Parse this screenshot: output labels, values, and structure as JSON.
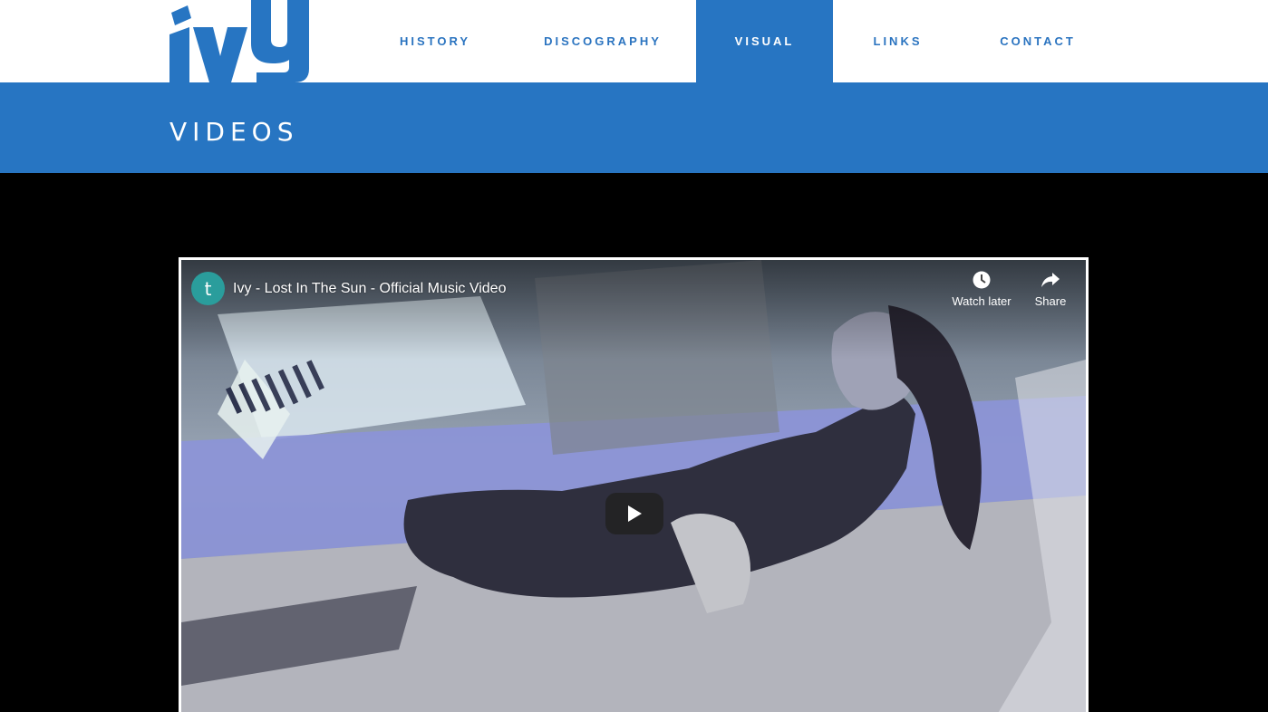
{
  "brand": {
    "logo_text": "ivy",
    "color": "#2775c2"
  },
  "nav": {
    "items": [
      {
        "label": "HISTORY",
        "active": false
      },
      {
        "label": "DISCOGRAPHY",
        "active": false
      },
      {
        "label": "VISUAL",
        "active": true
      },
      {
        "label": "LINKS",
        "active": false
      },
      {
        "label": "CONTACT",
        "active": false
      }
    ]
  },
  "banner": {
    "title": "VIDEOS"
  },
  "video": {
    "channel_initial": "t",
    "title": "Ivy - Lost In The Sun - Official Music Video",
    "watch_later_label": "Watch later",
    "share_label": "Share",
    "icons": {
      "watch_later": "clock-icon",
      "share": "share-icon",
      "play": "play-icon"
    }
  }
}
